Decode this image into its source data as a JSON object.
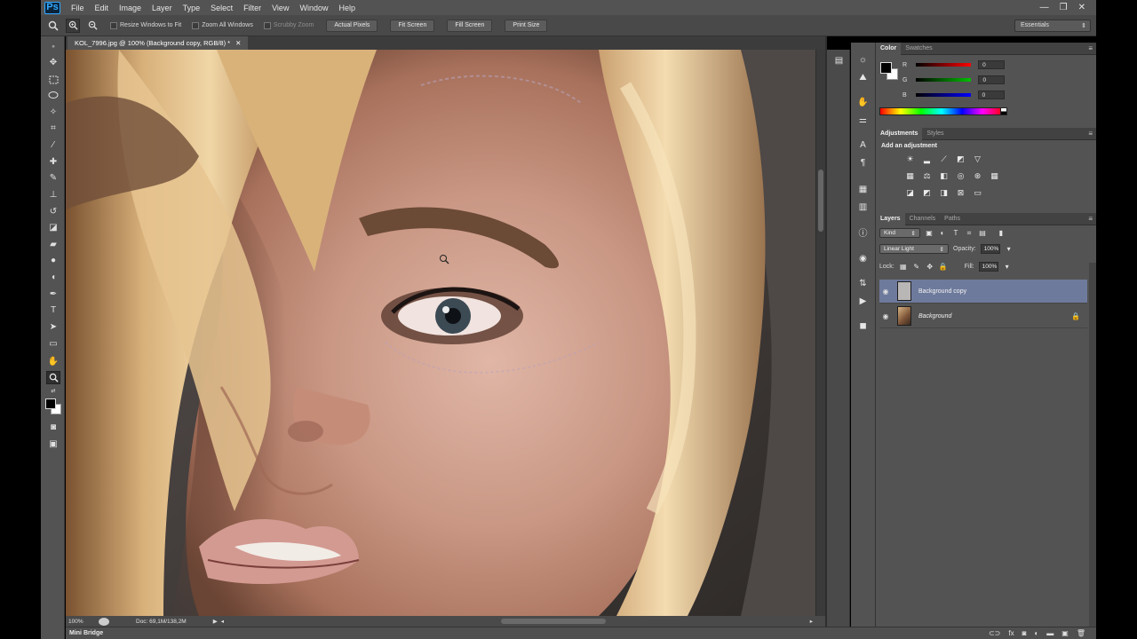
{
  "app": {
    "logo": "Ps",
    "window_controls": [
      "—",
      "❐",
      "✕"
    ]
  },
  "menu": [
    "File",
    "Edit",
    "Image",
    "Layer",
    "Type",
    "Select",
    "Filter",
    "View",
    "Window",
    "Help"
  ],
  "options_bar": {
    "resize_windows": "Resize Windows to Fit",
    "zoom_all": "Zoom All Windows",
    "scrubby": "Scrubby Zoom",
    "buttons": [
      "Actual Pixels",
      "Fit Screen",
      "Fill Screen",
      "Print Size"
    ],
    "workspace": "Essentials"
  },
  "document": {
    "tab_title": "KOL_7996.jpg @ 100% (Background copy, RGB/8) *",
    "zoom": "100%",
    "doc_info": "Doc: 69,1M/138,2M"
  },
  "mini_bridge": "Mini Bridge",
  "color_panel": {
    "tabs": [
      "Color",
      "Swatches"
    ],
    "channels": [
      {
        "label": "R",
        "value": "0",
        "gradient": "#ff0000"
      },
      {
        "label": "G",
        "value": "0",
        "gradient": "#00c000"
      },
      {
        "label": "B",
        "value": "0",
        "gradient": "#0000ff"
      }
    ]
  },
  "adjustments_panel": {
    "tabs": [
      "Adjustments",
      "Styles"
    ],
    "title": "Add an adjustment",
    "icons": [
      [
        "brightness-icon",
        "levels-icon",
        "curves-icon",
        "exposure-icon",
        "vibrance-icon",
        ""
      ],
      [
        "hue-saturation-icon",
        "color-balance-icon",
        "black-white-icon",
        "photo-filter-icon",
        "channel-mixer-icon",
        "color-lookup-icon"
      ],
      [
        "invert-icon",
        "posterize-icon",
        "threshold-icon",
        "selective-color-icon",
        "gradient-map-icon",
        ""
      ]
    ]
  },
  "layers_panel": {
    "tabs": [
      "Layers",
      "Channels",
      "Paths"
    ],
    "filter_kind": "Kind",
    "blend_mode": "Linear Light",
    "opacity_label": "Opacity:",
    "opacity": "100%",
    "lock_label": "Lock:",
    "fill_label": "Fill:",
    "fill": "100%",
    "layers": [
      {
        "name": "Background copy",
        "selected": true,
        "visible": true
      },
      {
        "name": "Background",
        "selected": false,
        "visible": true,
        "locked": true
      }
    ]
  }
}
